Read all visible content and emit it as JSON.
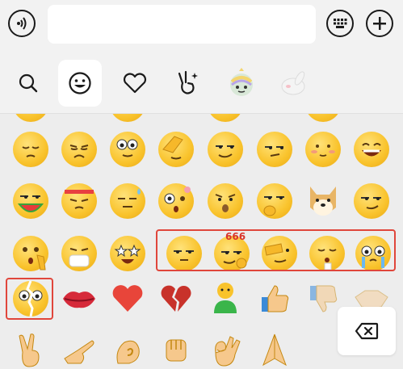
{
  "input": {
    "value": ""
  },
  "tabs": [
    {
      "name": "search",
      "icon": "search-icon",
      "active": false
    },
    {
      "name": "emoji",
      "icon": "smiley-icon",
      "active": true
    },
    {
      "name": "favorites",
      "icon": "heart-icon",
      "active": false
    },
    {
      "name": "stickers",
      "icon": "peace-hand-icon",
      "active": false
    },
    {
      "name": "sticker-pack-1",
      "icon": "unicorn-sticker-icon",
      "active": false
    },
    {
      "name": "sticker-pack-2",
      "icon": "rabbit-sticker-icon",
      "active": false
    }
  ],
  "grid": {
    "rows": [
      [
        "pensive",
        "frown",
        "glasses-flex",
        "facepalm",
        "smirk",
        "side-eye",
        "shy",
        "grin-tongue"
      ],
      [
        "watermelon-eat",
        "headband",
        "sweat",
        "surprised-eye",
        "sigh",
        "smirk-fist",
        "doge",
        "smug"
      ],
      [
        "shh",
        "mask",
        "star-eyes",
        "meh",
        "666",
        "eye-cover",
        "pout",
        "teary"
      ],
      [
        "crack-face",
        "lips",
        "heart",
        "broken-heart",
        "green-man",
        "thumbs-up",
        "thumbs-down",
        "handshake"
      ],
      [
        "victory",
        "point",
        "pray-spiral",
        "fist",
        "ok-hand",
        "pray"
      ]
    ],
    "badge_666": "666"
  },
  "colors": {
    "highlight": "#e0463b",
    "emoji_yellow": "#f9c32c"
  }
}
